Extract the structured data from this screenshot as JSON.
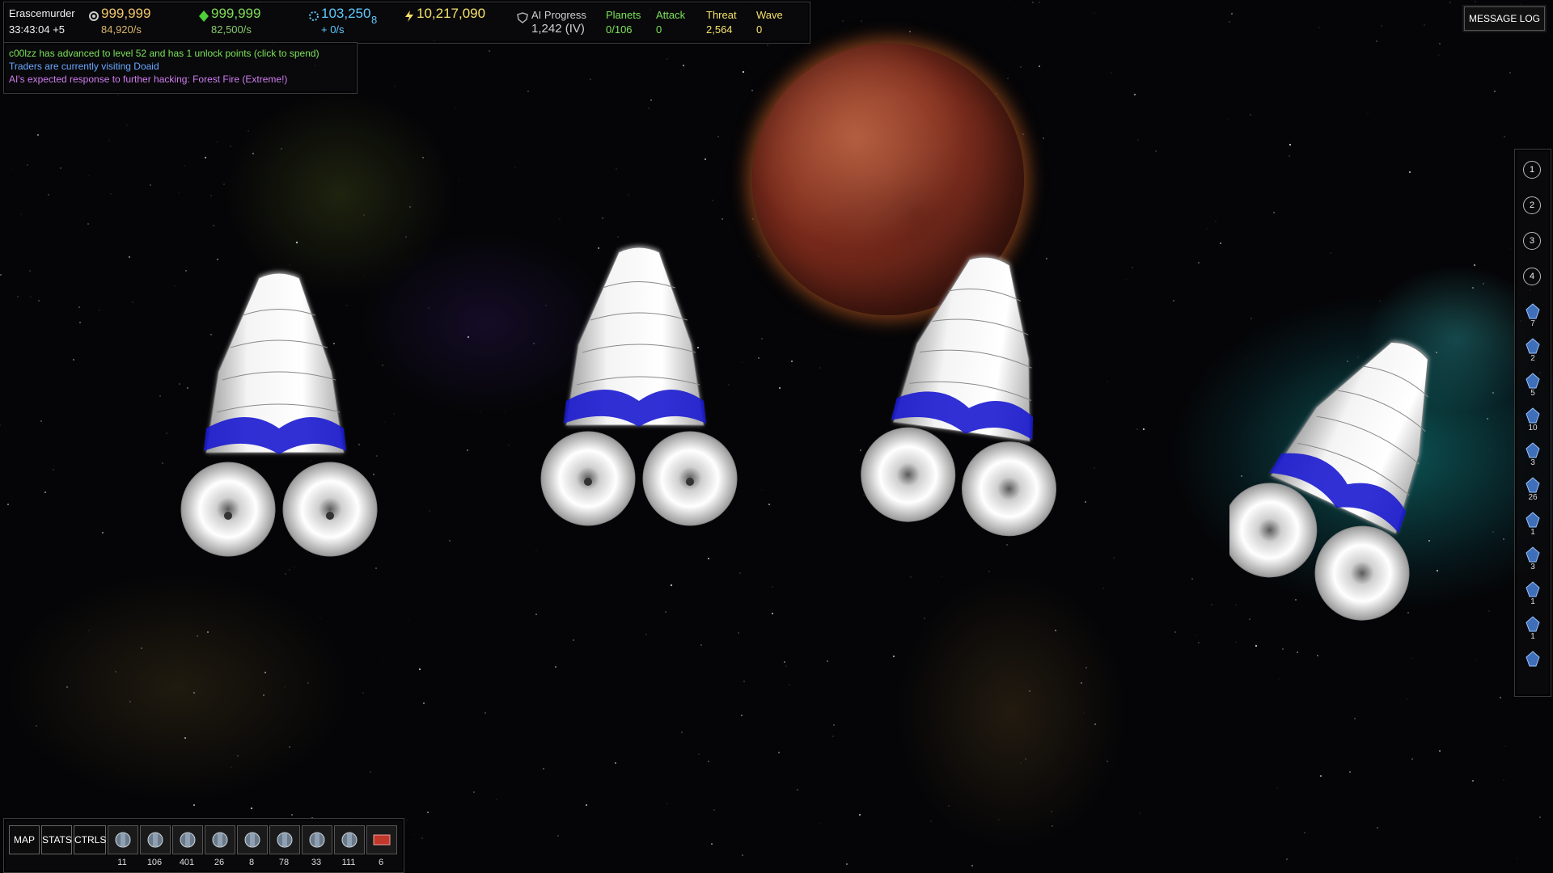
{
  "top_bar": {
    "player_name": "Erascemurder",
    "game_time": "33:43:04 +5",
    "metal": {
      "value": "999,999",
      "rate": "84,920/s",
      "color": "#f3c66a",
      "icon": "metal-icon"
    },
    "crystal": {
      "value": "999,999",
      "rate": "82,500/s",
      "color": "#7ddd55",
      "icon": "crystal-icon"
    },
    "hacking": {
      "value": "103,250",
      "sub": "8",
      "rate": "+ 0/s",
      "color": "#5fc9ff",
      "icon": "hacking-icon"
    },
    "energy": {
      "value": "10,217,090",
      "color": "#f5e26a",
      "icon": "energy-icon"
    },
    "ai_progress": {
      "label": "AI Progress",
      "value": "1,242 (IV)"
    },
    "planets": {
      "label": "Planets",
      "value": "0/106"
    },
    "attack": {
      "label": "Attack",
      "value": "0"
    },
    "threat": {
      "label": "Threat",
      "value": "2,564"
    },
    "wave": {
      "label": "Wave",
      "value": "0"
    }
  },
  "messages": [
    {
      "text": "c00lzz has advanced to level 52 and has 1 unlock points (click to spend)",
      "color": "#7ce25a"
    },
    {
      "text": "Traders are currently visiting Doaid",
      "color": "#6aa8ff"
    },
    {
      "text": "AI's expected response to further hacking: Forest Fire (Extreme!)",
      "color": "#d07cf0"
    }
  ],
  "message_log_button": "MESSAGE LOG",
  "control_groups": [
    "1",
    "2",
    "3",
    "4"
  ],
  "sidebar_fleet": [
    {
      "icon": "fighter-icon",
      "count": "7"
    },
    {
      "icon": "raider-icon",
      "count": "2"
    },
    {
      "icon": "bomber-icon",
      "count": "5"
    },
    {
      "icon": "frigate-icon",
      "count": "10"
    },
    {
      "icon": "cruiser-icon",
      "count": "3"
    },
    {
      "icon": "turret-icon",
      "count": "26"
    },
    {
      "icon": "missile-icon",
      "count": "1"
    },
    {
      "icon": "drone-icon",
      "count": "3"
    },
    {
      "icon": "engineer-icon",
      "count": "1"
    },
    {
      "icon": "rebuilder-icon",
      "count": "1"
    },
    {
      "icon": "flagship-icon",
      "count": ""
    }
  ],
  "bottom_bar": {
    "map": "MAP",
    "stats": "STATS",
    "ctrls": "CTRLS",
    "fleet": [
      {
        "icon": "mark-i-icon",
        "count": "11"
      },
      {
        "icon": "shield-generator-icon",
        "count": "106"
      },
      {
        "icon": "gravity-icon",
        "count": "401"
      },
      {
        "icon": "guardian-icon",
        "count": "26"
      },
      {
        "icon": "spider-icon",
        "count": "8"
      },
      {
        "icon": "diamond-icon",
        "count": "78"
      },
      {
        "icon": "skull-icon",
        "count": "33"
      },
      {
        "icon": "factory-icon",
        "count": "111"
      },
      {
        "icon": "red-card-icon",
        "count": "6"
      }
    ]
  }
}
